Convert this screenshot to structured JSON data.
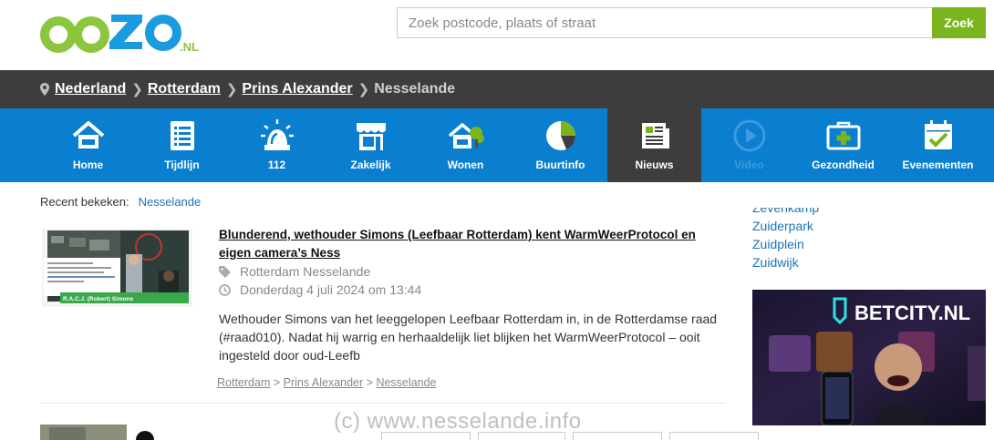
{
  "logo": {
    "text": "oozo",
    "suffix": ".NL"
  },
  "search": {
    "placeholder": "Zoek postcode, plaats of straat",
    "button": "Zoek"
  },
  "breadcrumb": {
    "items": [
      "Nederland",
      "Rotterdam",
      "Prins Alexander"
    ],
    "current": "Nesselande"
  },
  "nav": {
    "items": [
      {
        "label": "Home",
        "icon": "home-icon"
      },
      {
        "label": "Tijdlijn",
        "icon": "timeline-icon"
      },
      {
        "label": "112",
        "icon": "siren-icon"
      },
      {
        "label": "Zakelijk",
        "icon": "shop-icon"
      },
      {
        "label": "Wonen",
        "icon": "house-tree-icon"
      },
      {
        "label": "Buurtinfo",
        "icon": "pie-chart-icon"
      },
      {
        "label": "Nieuws",
        "icon": "newspaper-icon"
      },
      {
        "label": "Video",
        "icon": "play-icon"
      },
      {
        "label": "Gezondheid",
        "icon": "medkit-icon"
      },
      {
        "label": "Evenementen",
        "icon": "calendar-icon"
      }
    ],
    "active": "Nieuws"
  },
  "recent": {
    "label": "Recent bekeken:",
    "link": "Nesselande"
  },
  "article": {
    "title": "Blunderend, wethouder Simons (Leefbaar Rotterdam) kent WarmWeerProtocol en eigen camera’s Ness",
    "location": "Rotterdam Nesselande",
    "date": "Donderdag 4 juli 2024 om 13:44",
    "excerpt": "Wethouder Simons van het leeggelopen Leefbaar Rotterdam in, in de Rotterdamse raad (#raad010). Nadat hij warrig en herhaaldelijk liet blijken het WarmWeerProtocol – ooit ingesteld door oud-Leefb",
    "crumbs": [
      "Rotterdam",
      "Prins Alexander",
      "Nesselande"
    ],
    "thumb_caption": "R.A.C.J. (Robert) Simons"
  },
  "sidebar": {
    "links": [
      "Zevenkamp",
      "Zuiderpark",
      "Zuidplein",
      "Zuidwijk"
    ]
  },
  "ad": {
    "brand": "BETCITY.NL"
  },
  "watermark": "(c)  www.nesselande.info",
  "colors": {
    "nav_blue": "#0a7ecf",
    "dark_bar": "#3d3d3d",
    "accent_green": "#7ab51d",
    "link_blue": "#1a73b8"
  }
}
